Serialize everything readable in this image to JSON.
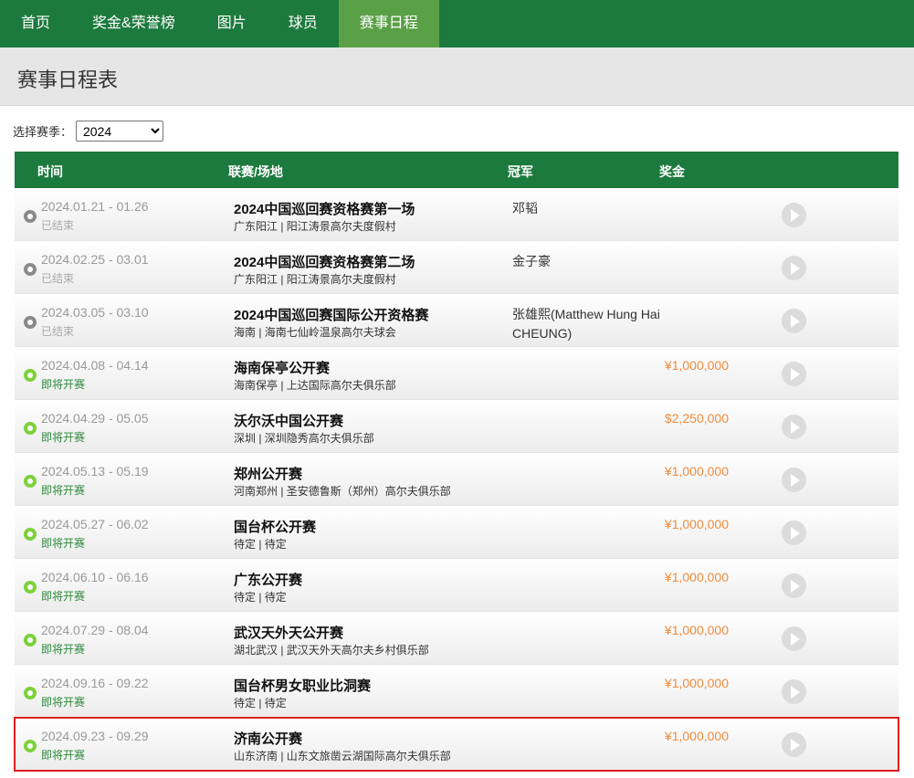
{
  "nav": {
    "items": [
      {
        "label": "首页",
        "active": false
      },
      {
        "label": "奖金&荣誉榜",
        "active": false
      },
      {
        "label": "图片",
        "active": false
      },
      {
        "label": "球员",
        "active": false
      },
      {
        "label": "赛事日程",
        "active": true
      }
    ]
  },
  "page": {
    "title": "赛事日程表"
  },
  "season": {
    "label": "选择赛季：",
    "selected": "2024"
  },
  "table": {
    "headers": {
      "time": "时间",
      "event": "联赛/场地",
      "champion": "冠军",
      "prize": "奖金"
    },
    "rows": [
      {
        "date": "2024.01.21 - 01.26",
        "status": "已结束",
        "state": "done",
        "name": "2024中国巡回赛资格赛第一场",
        "venue": "广东阳江 | 阳江涛景高尔夫度假村",
        "champion": "邓韬",
        "prize": ""
      },
      {
        "date": "2024.02.25 - 03.01",
        "status": "已结束",
        "state": "done",
        "name": "2024中国巡回赛资格赛第二场",
        "venue": "广东阳江 | 阳江涛景高尔夫度假村",
        "champion": "金子豪",
        "prize": ""
      },
      {
        "date": "2024.03.05 - 03.10",
        "status": "已结束",
        "state": "done",
        "name": "2024中国巡回赛国际公开资格赛",
        "venue": "海南 | 海南七仙岭温泉高尔夫球会",
        "champion": "张雄熙(Matthew Hung Hai CHEUNG)",
        "prize": ""
      },
      {
        "date": "2024.04.08 - 04.14",
        "status": "即将开赛",
        "state": "upcoming",
        "name": "海南保亭公开赛",
        "venue": "海南保亭 | 上达国际高尔夫俱乐部",
        "champion": "",
        "prize": "¥1,000,000"
      },
      {
        "date": "2024.04.29 - 05.05",
        "status": "即将开赛",
        "state": "upcoming",
        "name": "沃尔沃中国公开赛",
        "venue": "深圳 | 深圳隐秀高尔夫俱乐部",
        "champion": "",
        "prize": "$2,250,000"
      },
      {
        "date": "2024.05.13 - 05.19",
        "status": "即将开赛",
        "state": "upcoming",
        "name": "郑州公开赛",
        "venue": "河南郑州 | 圣安德鲁斯（郑州）高尔夫俱乐部",
        "champion": "",
        "prize": "¥1,000,000"
      },
      {
        "date": "2024.05.27 - 06.02",
        "status": "即将开赛",
        "state": "upcoming",
        "name": "国台杯公开赛",
        "venue": "待定 | 待定",
        "champion": "",
        "prize": "¥1,000,000"
      },
      {
        "date": "2024.06.10 - 06.16",
        "status": "即将开赛",
        "state": "upcoming",
        "name": "广东公开赛",
        "venue": "待定 | 待定",
        "champion": "",
        "prize": "¥1,000,000"
      },
      {
        "date": "2024.07.29 - 08.04",
        "status": "即将开赛",
        "state": "upcoming",
        "name": "武汉天外天公开赛",
        "venue": "湖北武汉 | 武汉天外天高尔夫乡村俱乐部",
        "champion": "",
        "prize": "¥1,000,000"
      },
      {
        "date": "2024.09.16 - 09.22",
        "status": "即将开赛",
        "state": "upcoming",
        "name": "国台杯男女职业比洞赛",
        "venue": "待定 | 待定",
        "champion": "",
        "prize": "¥1,000,000"
      },
      {
        "date": "2024.09.23 - 09.29",
        "status": "即将开赛",
        "state": "upcoming",
        "name": "济南公开赛",
        "venue": "山东济南 | 山东文旅凿云湖国际高尔夫俱乐部",
        "champion": "",
        "prize": "¥1,000,000",
        "highlighted": true
      }
    ]
  },
  "colors": {
    "nav_bg": "#1d7a3e",
    "nav_active": "#5aa046",
    "prize": "#f28a3c",
    "upcoming_status": "#2c8a3a",
    "highlight_border": "#e02020"
  }
}
